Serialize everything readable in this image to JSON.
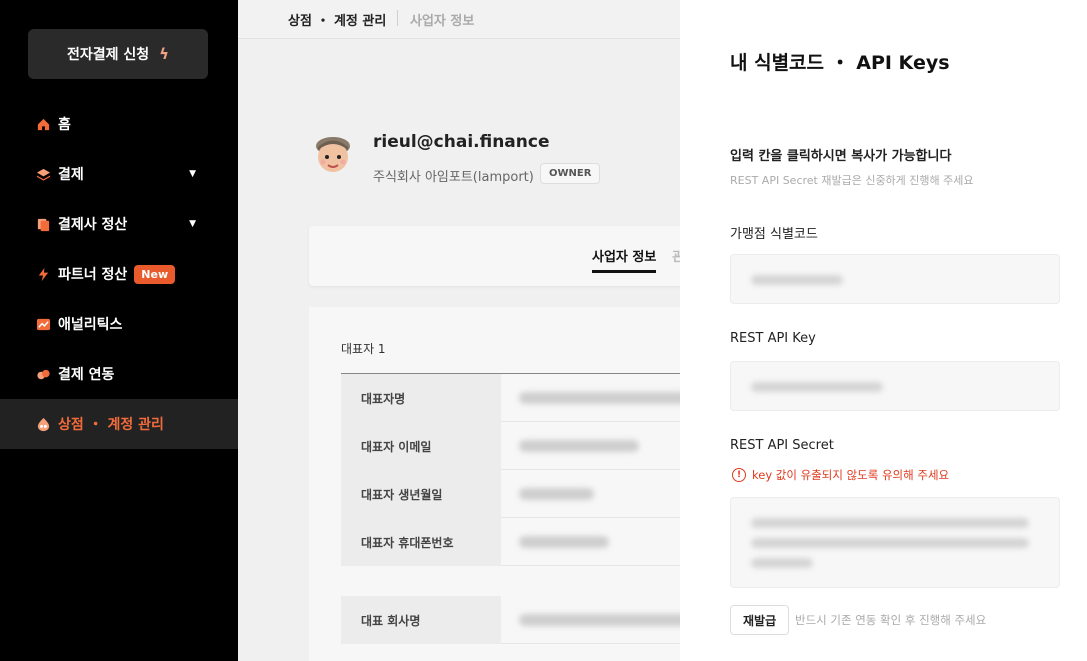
{
  "sidebar": {
    "apply_button": "전자결제 신청",
    "items": [
      {
        "label": "홈",
        "icon": "home-icon",
        "caret": false
      },
      {
        "label": "결제",
        "icon": "layers-icon",
        "caret": true
      },
      {
        "label": "결제사 정산",
        "icon": "documents-icon",
        "caret": true
      },
      {
        "label": "파트너 정산",
        "icon": "bolt-icon",
        "caret": false,
        "badge": "New"
      },
      {
        "label": "애널리틱스",
        "icon": "chart-icon",
        "caret": false
      },
      {
        "label": "결제 연동",
        "icon": "link-icon",
        "caret": false
      },
      {
        "label": "상점 ・ 계정 관리",
        "icon": "store-icon",
        "caret": false,
        "active": true
      }
    ]
  },
  "breadcrumb": {
    "current": "상점 ・ 계정 관리",
    "next": "사업자 정보"
  },
  "profile": {
    "email": "rieul@chai.finance",
    "company": "주식회사 아임포트(lamport)",
    "role": "OWNER"
  },
  "tabs": {
    "active": "사업자 정보",
    "next": "관"
  },
  "info": {
    "section_title": "대표자 1",
    "rows": [
      "대표자명",
      "대표자 이메일",
      "대표자 생년월일",
      "대표자 휴대폰번호"
    ],
    "company_row": "대표 회사명"
  },
  "drawer": {
    "title": "내 식별코드 ・ API Keys",
    "desc": "입력 칸을 클릭하시면 복사가 가능합니다",
    "subdesc": "REST API Secret 재발급은 신중하게 진행해 주세요",
    "field_merchant_code": "가맹점 식별코드",
    "field_api_key": "REST API Key",
    "field_api_secret": "REST API Secret",
    "warning": "key 값이 유출되지 않도록 유의해 주세요",
    "reissue_button": "재발급",
    "reissue_note": "반드시 기존 연동 확인 후 진행해 주세요"
  },
  "colors": {
    "accent": "#f26b3a",
    "badge": "#e95b2d",
    "warning": "#e03b1f"
  }
}
